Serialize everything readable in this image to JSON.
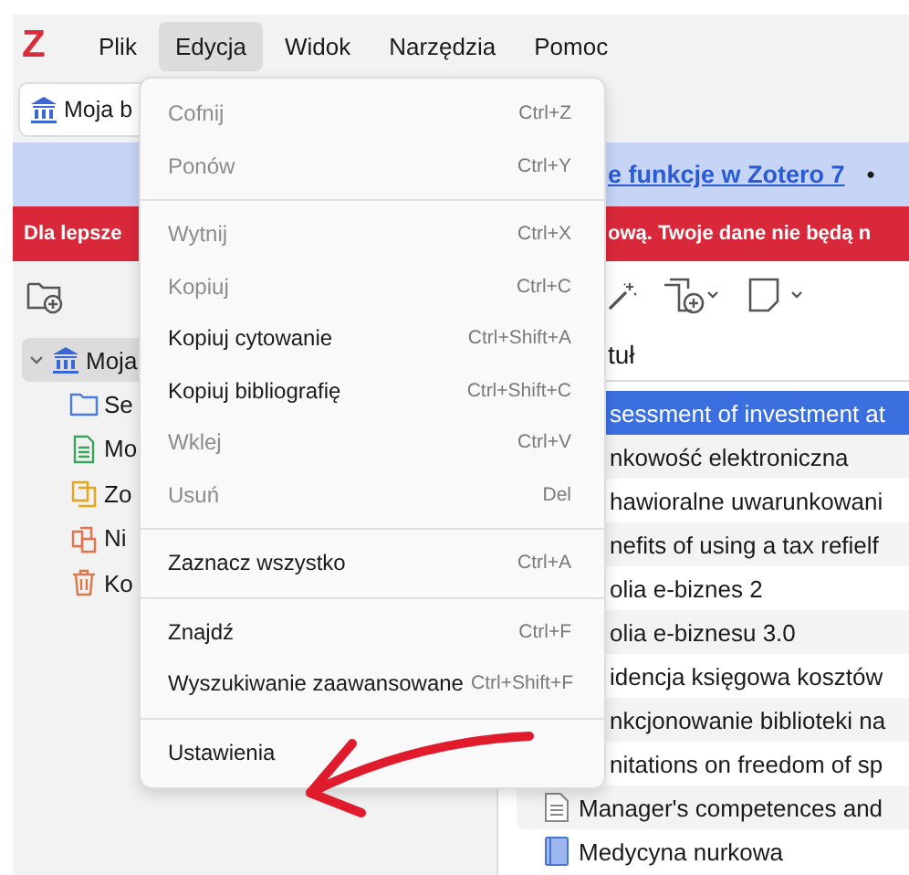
{
  "logo": "Z",
  "menubar": {
    "items": [
      {
        "label": "Plik",
        "selected": false
      },
      {
        "label": "Edycja",
        "selected": true
      },
      {
        "label": "Widok",
        "selected": false
      },
      {
        "label": "Narzędzia",
        "selected": false
      },
      {
        "label": "Pomoc",
        "selected": false
      }
    ]
  },
  "library_tab": {
    "label": "Moja b"
  },
  "info_banner": {
    "link": "e funkcje w Zotero 7",
    "bullet": "•"
  },
  "warning_banner": {
    "left_text": "Dla lepsze",
    "right_text": "ową. Twoje dane nie będą n"
  },
  "sidebar": {
    "items": [
      {
        "label": "Moja",
        "expanded": true,
        "selected": true,
        "children": [
          {
            "label": "Se",
            "kind": "folder"
          },
          {
            "label": "Mo",
            "kind": "note"
          },
          {
            "label": "Zo",
            "kind": "duplicates"
          },
          {
            "label": "Ni",
            "kind": "unfiled"
          },
          {
            "label": "Ko",
            "kind": "trash"
          }
        ]
      }
    ]
  },
  "items_table": {
    "column_header": "tuł",
    "rows": [
      {
        "title": "sessment of investment at",
        "selected": true,
        "kind": "covered"
      },
      {
        "title": "nkowość elektroniczna",
        "selected": false,
        "kind": "covered"
      },
      {
        "title": "hawioralne uwarunkowani",
        "selected": false,
        "kind": "covered"
      },
      {
        "title": "nefits of using a tax refielf",
        "selected": false,
        "kind": "covered"
      },
      {
        "title": "olia e-biznes 2",
        "selected": false,
        "kind": "covered"
      },
      {
        "title": "olia e-biznesu 3.0",
        "selected": false,
        "kind": "covered"
      },
      {
        "title": "idencja księgowa kosztów",
        "selected": false,
        "kind": "covered"
      },
      {
        "title": "nkcjonowanie biblioteki na",
        "selected": false,
        "kind": "covered"
      },
      {
        "title": "nitations on freedom of sp",
        "selected": false,
        "kind": "covered"
      },
      {
        "title": "Manager's competences and",
        "selected": false,
        "kind": "document"
      },
      {
        "title": "Medycyna nurkowa",
        "selected": false,
        "kind": "book"
      }
    ]
  },
  "edit_menu": {
    "items": [
      {
        "kind": "item",
        "label": "Cofnij",
        "shortcut": "Ctrl+Z",
        "disabled": true
      },
      {
        "kind": "item",
        "label": "Ponów",
        "shortcut": "Ctrl+Y",
        "disabled": true
      },
      {
        "kind": "separator"
      },
      {
        "kind": "item",
        "label": "Wytnij",
        "shortcut": "Ctrl+X",
        "disabled": true
      },
      {
        "kind": "item",
        "label": "Kopiuj",
        "shortcut": "Ctrl+C",
        "disabled": true
      },
      {
        "kind": "item",
        "label": "Kopiuj cytowanie",
        "shortcut": "Ctrl+Shift+A",
        "disabled": false
      },
      {
        "kind": "item",
        "label": "Kopiuj bibliografię",
        "shortcut": "Ctrl+Shift+C",
        "disabled": false
      },
      {
        "kind": "item",
        "label": "Wklej",
        "shortcut": "Ctrl+V",
        "disabled": true
      },
      {
        "kind": "item",
        "label": "Usuń",
        "shortcut": "Del",
        "disabled": true
      },
      {
        "kind": "separator"
      },
      {
        "kind": "item",
        "label": "Zaznacz wszystko",
        "shortcut": "Ctrl+A",
        "disabled": false
      },
      {
        "kind": "separator"
      },
      {
        "kind": "item",
        "label": "Znajdź",
        "shortcut": "Ctrl+F",
        "disabled": false
      },
      {
        "kind": "item",
        "label": "Wyszukiwanie zaawansowane",
        "shortcut": "Ctrl+Shift+F",
        "disabled": false
      },
      {
        "kind": "separator"
      },
      {
        "kind": "item",
        "label": "Ustawienia",
        "disabled": false
      }
    ]
  }
}
